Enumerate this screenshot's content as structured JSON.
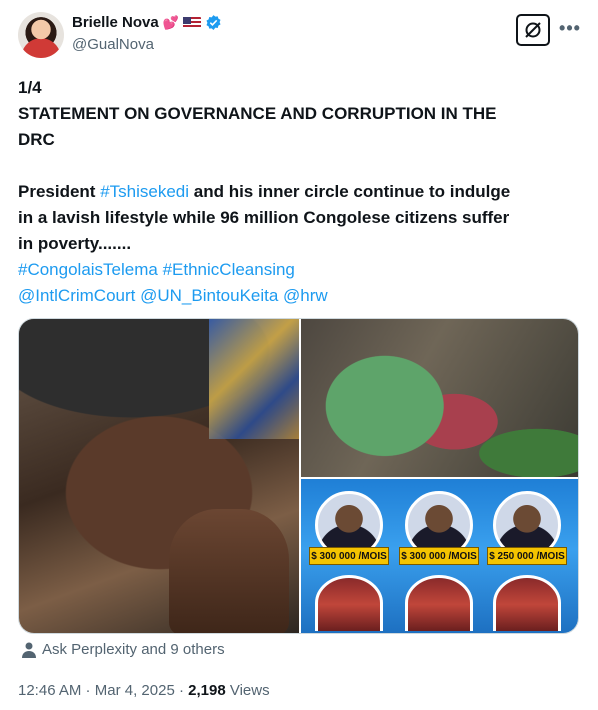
{
  "author": {
    "name": "Brielle Nova",
    "handle": "@GualNova"
  },
  "icons": {
    "heart": "heart-icon",
    "flag": "us-flag-icon",
    "verified": "verified-badge-icon",
    "grok": "grok-icon",
    "more": "more-icon",
    "person": "person-icon"
  },
  "tweet": {
    "counter": "1/4",
    "heading_line1": "STATEMENT ON GOVERNANCE AND CORRUPTION IN THE",
    "heading_line2": "DRC",
    "body_prefix": "President ",
    "body_hashtag": "#Tshisekedi",
    "body_line1_rest": " and his inner circle continue to indulge",
    "body_line2": "in a lavish lifestyle while 96 million Congolese citizens suffer",
    "body_line3": "in poverty.......",
    "hashtags_line": "#CongolaisTelema #EthnicCleansing",
    "mentions_line": "@IntlCrimCourt @UN_BintouKeita @hrw"
  },
  "media": {
    "price_tags": [
      "$ 300 000 /MOIS",
      "$ 300 000 /MOIS",
      "$ 250 000 /MOIS"
    ]
  },
  "liked_by": "Ask Perplexity and 9 others",
  "meta": {
    "time": "12:46 AM",
    "separator": " · ",
    "date": "Mar 4, 2025",
    "views_count": "2,198",
    "views_label": " Views"
  },
  "colors": {
    "link": "#1d9bf0",
    "secondary_text": "#536471",
    "verified": "#1d9bf0"
  }
}
